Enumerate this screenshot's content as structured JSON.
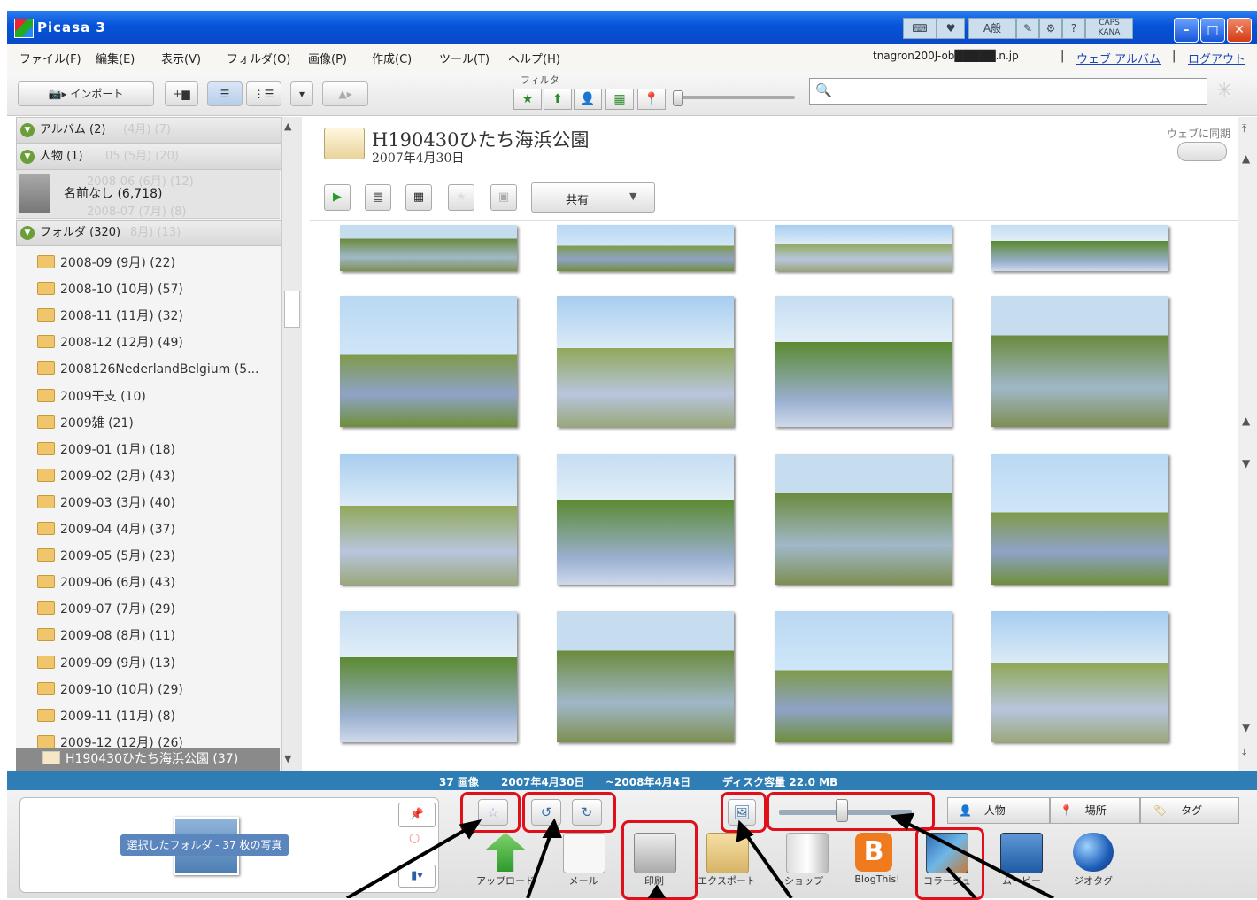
{
  "window": {
    "title": "Picasa 3"
  },
  "ime": {
    "lang": "A般",
    "caps": "CAPS",
    "kana": "KANA"
  },
  "menu": [
    "ファイル(F)",
    "編集(E)",
    "表示(V)",
    "フォルダ(O)",
    "画像(P)",
    "作成(C)",
    "ツール(T)",
    "ヘルプ(H)"
  ],
  "account": {
    "email": "tnagron200J-ob█████.n.jp",
    "sep": "|",
    "web_album": "ウェブ アルバム",
    "logout": "ログアウト"
  },
  "toolbar": {
    "import": "インポート",
    "filter_label": "フィルタ",
    "search_placeholder": ""
  },
  "sidebar": {
    "albums": {
      "label": "アルバム (2)",
      "ghost": "(4月) (7)"
    },
    "people": {
      "label": "人物 (1)",
      "ghost": "05 (5月) (20)"
    },
    "person": {
      "label": "名前なし (6,718)",
      "ghost1": "2008-06 (6月) (12)",
      "ghost2": "2008-07 (7月) (8)"
    },
    "folders": {
      "label": "フォルダ (320)",
      "ghost": "8月) (13)"
    },
    "folder_items": [
      "2008-09 (9月) (22)",
      "2008-10 (10月) (57)",
      "2008-11 (11月) (32)",
      "2008-12 (12月) (49)",
      "2008126NederlandBelgium (5...",
      "2009干支 (10)",
      "2009雑 (21)",
      "2009-01 (1月) (18)",
      "2009-02 (2月) (43)",
      "2009-03 (3月) (40)",
      "2009-04 (4月) (37)",
      "2009-05 (5月) (23)",
      "2009-06 (6月) (43)",
      "2009-07 (7月) (29)",
      "2009-08 (8月) (11)",
      "2009-09 (9月) (13)",
      "2009-10 (10月) (29)",
      "2009-11 (11月) (8)",
      "2009-12 (12月) (26)"
    ],
    "selected_folder": "H190430ひたち海浜公園 (37)"
  },
  "album": {
    "title": "H190430ひたち海浜公園",
    "date": "2007年4月30日",
    "share": "共有",
    "sync": "ウェブに同期"
  },
  "status": {
    "count": "37 画像",
    "date_from": "2007年4月30日",
    "date_to": "~2008年4月4日",
    "disk": "ディスク容量 22.0 MB"
  },
  "tray": {
    "selection": "選択したフォルダ - 37 枚の写真",
    "actions": [
      "アップロード",
      "メール",
      "印刷",
      "エクスポート",
      "ショップ",
      "BlogThis!",
      "コラージュ",
      "ムービー",
      "ジオタグ"
    ],
    "people": "人物",
    "places": "場所",
    "tags": "タグ"
  },
  "colors": {
    "accent": "#0553d8",
    "status": "#2e7db4",
    "highlight": "#e0101a"
  }
}
